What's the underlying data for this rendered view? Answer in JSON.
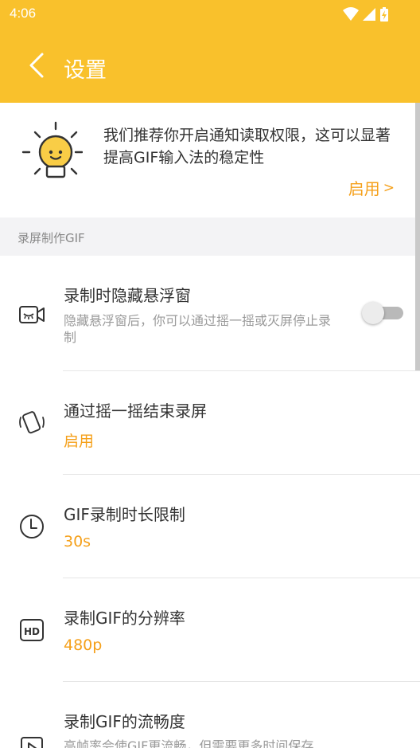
{
  "status_bar": {
    "time": "4:06"
  },
  "app_bar": {
    "title": "设置"
  },
  "banner": {
    "message": "我们推荐你开启通知读取权限，这可以显著提高GIF输入法的稳定性",
    "action_label": "启用",
    "action_chevron": ">"
  },
  "section": {
    "title": "录屏制作GIF"
  },
  "settings": [
    {
      "title": "录制时隐藏悬浮窗",
      "description": "隐藏悬浮窗后，你可以通过摇一摇或灭屏停止录制",
      "toggle_on": false
    },
    {
      "title": "通过摇一摇结束录屏",
      "value": "启用"
    },
    {
      "title": "GIF录制时长限制",
      "value": "30s"
    },
    {
      "title": "录制GIF的分辨率",
      "value": "480p"
    },
    {
      "title": "录制GIF的流畅度",
      "description": "高帧率会使GIF更流畅，但需要更多时间保存"
    }
  ],
  "colors": {
    "primary": "#f9c12c",
    "accent": "#f5a01a",
    "section_bg": "#f3f3f5"
  },
  "icons": [
    "wifi-icon",
    "signal-icon",
    "battery-charging-icon",
    "back-arrow-icon",
    "lightbulb-icon",
    "video-camera-hidden-icon",
    "shake-phone-icon",
    "clock-icon",
    "hd-icon",
    "play-icon"
  ]
}
